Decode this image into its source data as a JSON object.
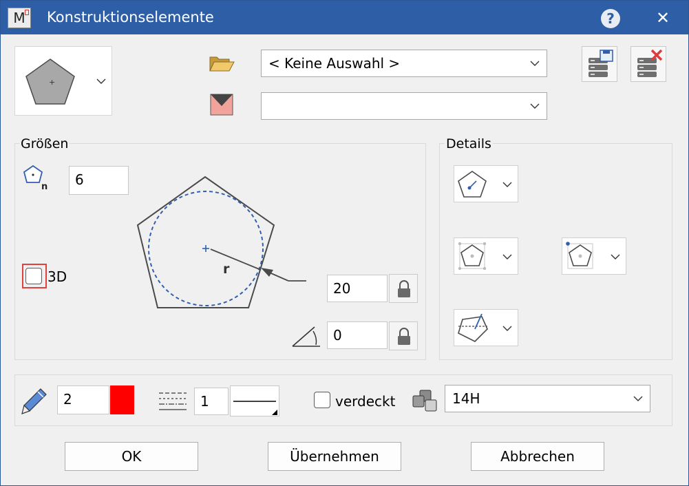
{
  "window": {
    "title": "Konstruktionselemente",
    "app_icon_letter": "M",
    "help_label": "?",
    "close_label": "✕"
  },
  "top": {
    "folder_combo_value": "< Keine Auswahl >",
    "layer_combo_value": ""
  },
  "sizes": {
    "group_label": "Größen",
    "sides_value": "6",
    "check_3d_label": "3D",
    "radius_value": "20",
    "angle_value": "0",
    "radius_symbol": "r"
  },
  "details": {
    "group_label": "Details"
  },
  "bottom": {
    "pen_value": "2",
    "color_hex": "#ff0000",
    "linetype_value": "1",
    "hidden_label": "verdeckt",
    "style_combo_value": "14H"
  },
  "buttons": {
    "ok": "OK",
    "apply": "Übernehmen",
    "cancel": "Abbrechen"
  },
  "colors": {
    "titlebar": "#2d5ea6",
    "accent_blue": "#2f5fae",
    "highlight_red": "#e04040"
  }
}
